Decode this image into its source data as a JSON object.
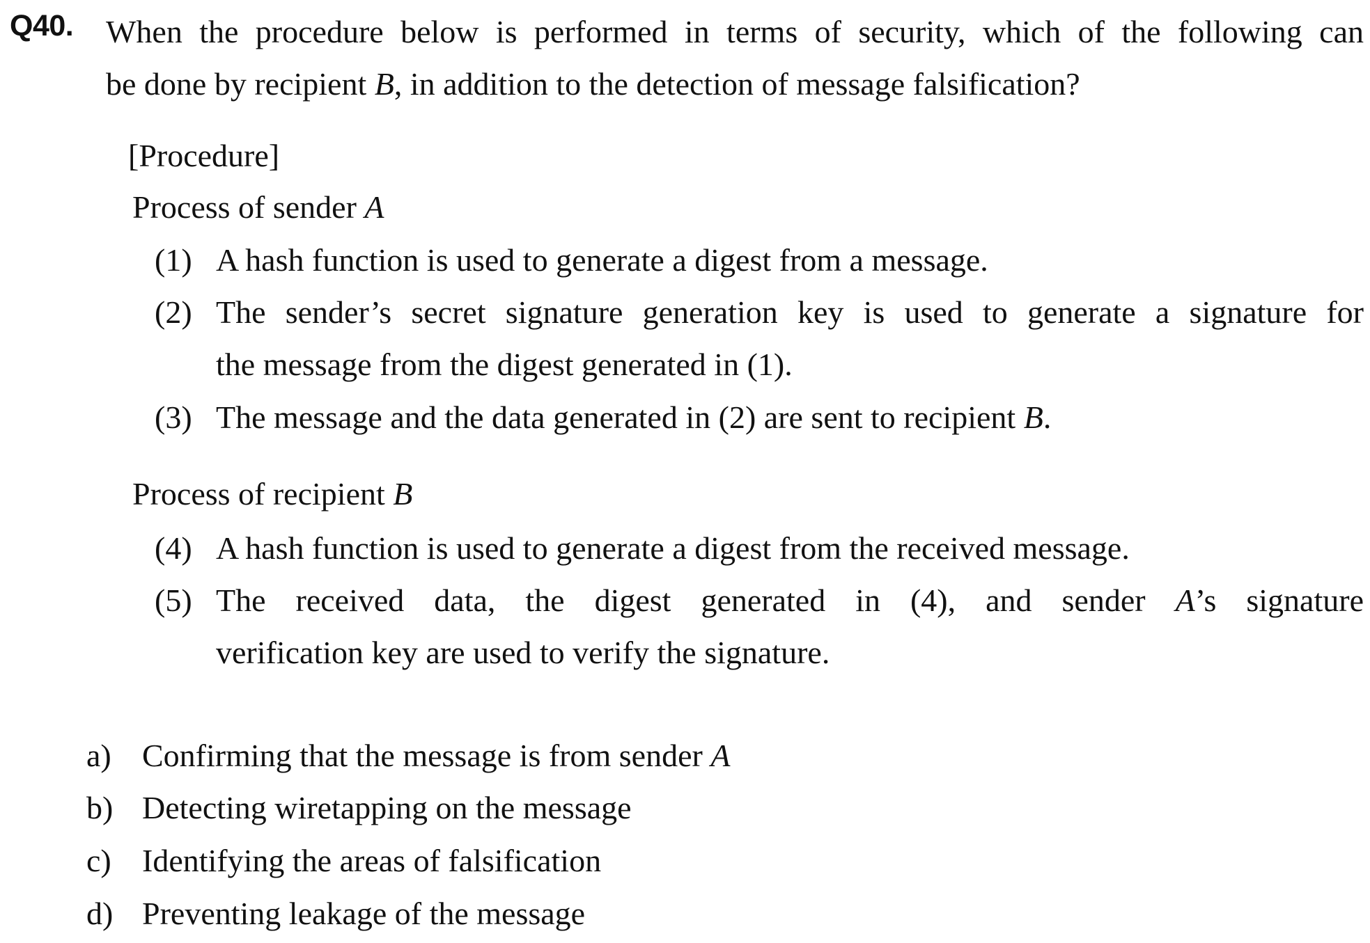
{
  "question": {
    "number": "Q40.",
    "text_line1": "When the procedure below is performed in terms of security, which of the following can",
    "text_line2_a": "be done by recipient ",
    "text_line2_b": "B",
    "text_line2_c": ", in addition to the detection of message falsification?"
  },
  "procedure": {
    "heading": "[Procedure]",
    "sender": {
      "heading_a": "Process of sender ",
      "heading_b": "A",
      "steps": [
        {
          "num": "(1)",
          "text": "A hash function is used to generate a digest from a message."
        },
        {
          "num": "(2)",
          "line1": "The sender’s secret signature generation key is used to generate a signature for",
          "line2": "the message from the digest generated in (1)."
        },
        {
          "num": "(3)",
          "text_a": "The message and the data generated in (2) are sent to recipient ",
          "text_b": "B",
          "text_c": "."
        }
      ]
    },
    "recipient": {
      "heading_a": "Process of recipient ",
      "heading_b": "B",
      "steps": [
        {
          "num": "(4)",
          "text": "A hash function is used to generate a digest from the received message."
        },
        {
          "num": "(5)",
          "line1_a": "The received data, the digest generated in (4), and sender ",
          "line1_b": "A",
          "line1_c": "’s signature",
          "line2": "verification key are used to verify the signature."
        }
      ]
    }
  },
  "options": [
    {
      "letter": "a)",
      "text_a": "Confirming that the message is from sender ",
      "text_b": "A"
    },
    {
      "letter": "b)",
      "text_a": "Detecting wiretapping on the message",
      "text_b": ""
    },
    {
      "letter": "c)",
      "text_a": "Identifying the areas of falsification",
      "text_b": ""
    },
    {
      "letter": "d)",
      "text_a": "Preventing leakage of the message",
      "text_b": ""
    }
  ]
}
